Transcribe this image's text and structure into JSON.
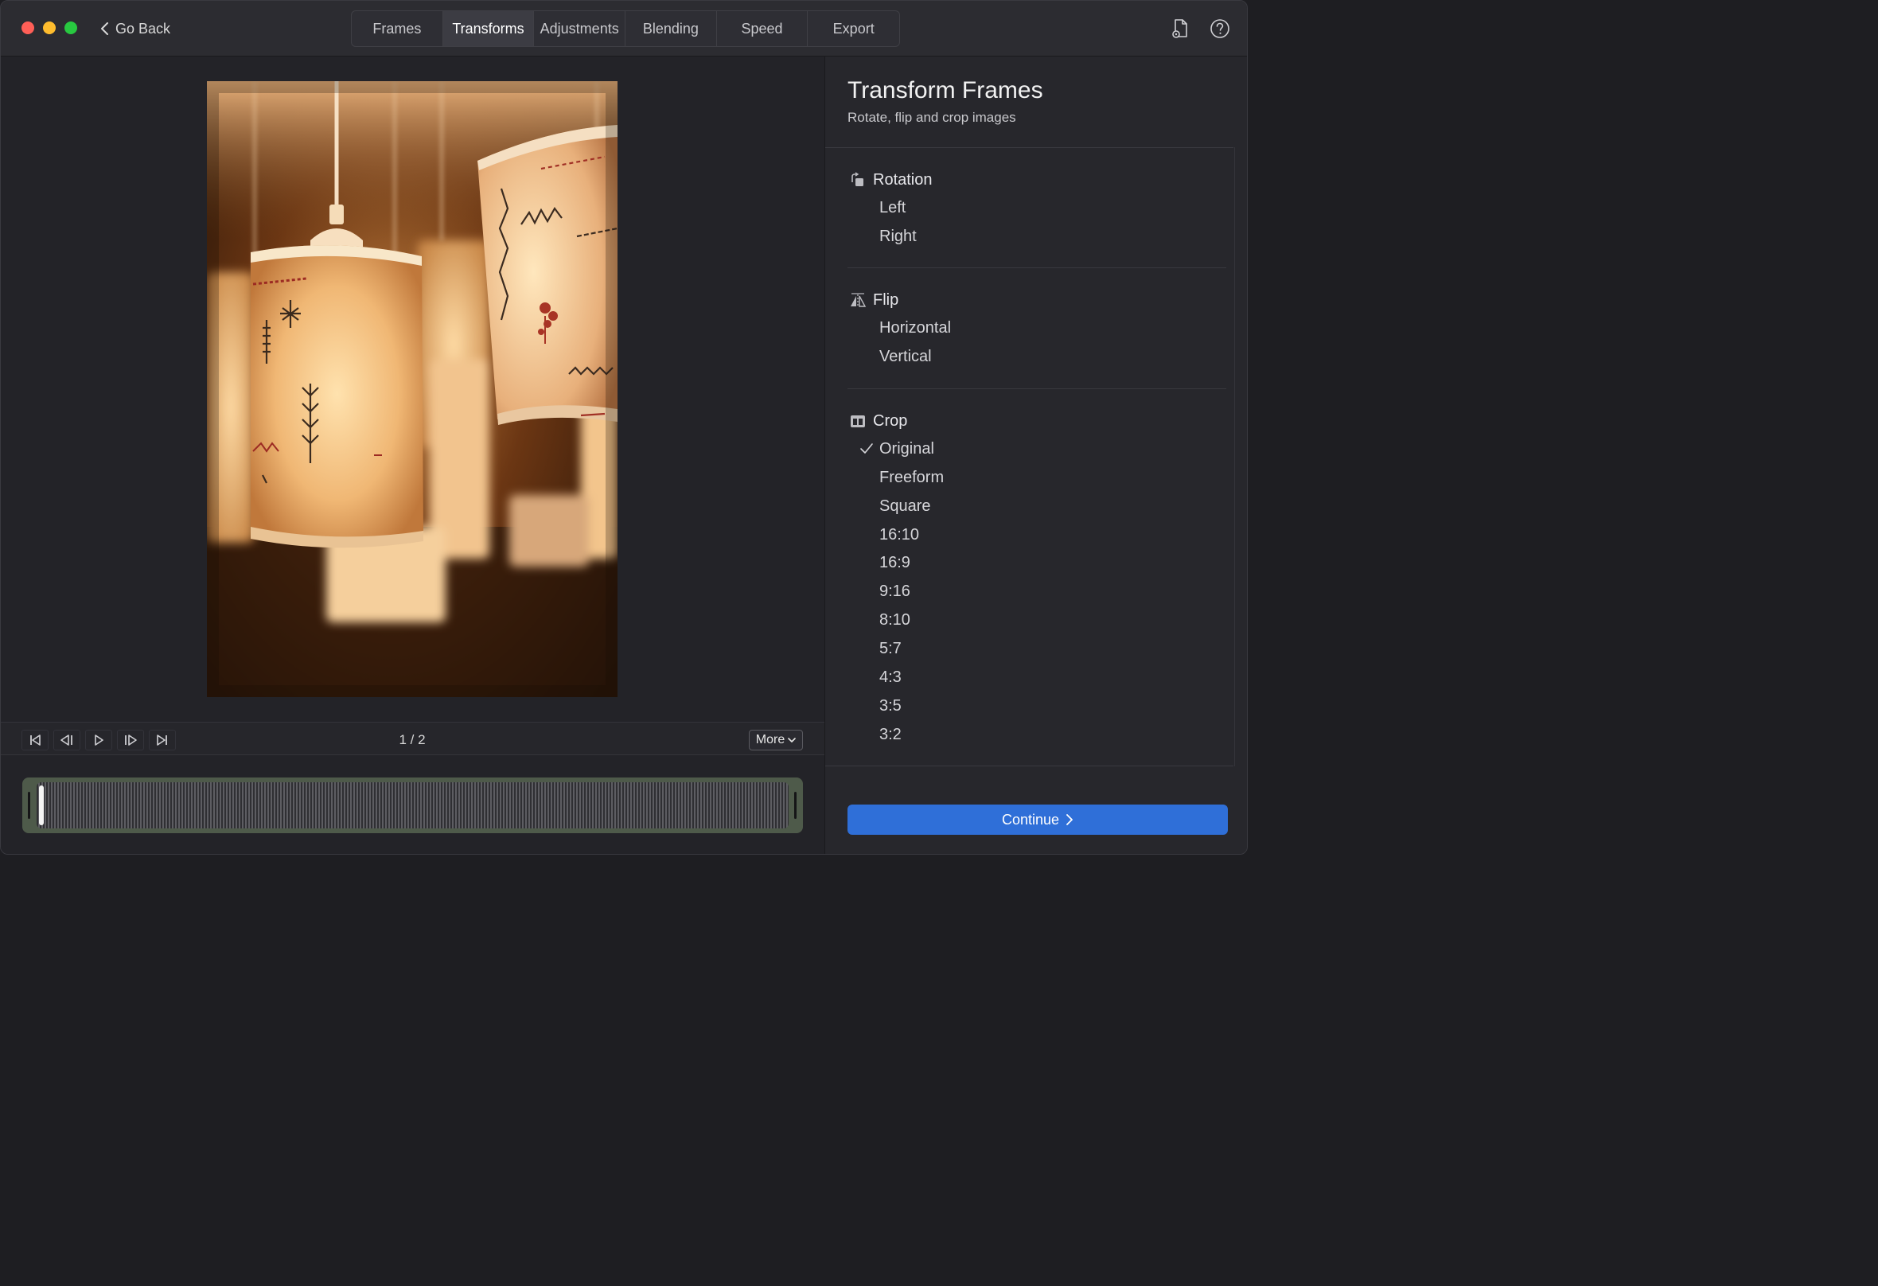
{
  "toolbar": {
    "go_back_label": "Go Back",
    "tabs": [
      {
        "label": "Frames",
        "active": false
      },
      {
        "label": "Transforms",
        "active": true
      },
      {
        "label": "Adjustments",
        "active": false
      },
      {
        "label": "Blending",
        "active": false
      },
      {
        "label": "Speed",
        "active": false
      },
      {
        "label": "Export",
        "active": false
      }
    ],
    "right_icons": [
      "document-settings-icon",
      "help-icon"
    ]
  },
  "preview": {
    "counter": "1 / 2",
    "more_label": "More",
    "playback_icons": [
      "skip-to-start-icon",
      "step-back-icon",
      "play-icon",
      "step-forward-icon",
      "skip-to-end-icon"
    ]
  },
  "sidebar": {
    "title": "Transform Frames",
    "subtitle": "Rotate, flip and crop images",
    "rotation": {
      "label": "Rotation",
      "icon": "rotate-icon",
      "options": [
        "Left",
        "Right"
      ]
    },
    "flip": {
      "label": "Flip",
      "icon": "flip-icon",
      "options": [
        "Horizontal",
        "Vertical"
      ]
    },
    "crop": {
      "label": "Crop",
      "icon": "crop-icon",
      "selected": "Original",
      "options": [
        "Original",
        "Freeform",
        "Square",
        "16:10",
        "16:9",
        "9:16",
        "8:10",
        "5:7",
        "4:3",
        "3:5",
        "3:2"
      ]
    },
    "continue_label": "Continue"
  },
  "colors": {
    "accent": "#2f6fd8",
    "background": "#25252b",
    "sidebar": "#27272c"
  }
}
